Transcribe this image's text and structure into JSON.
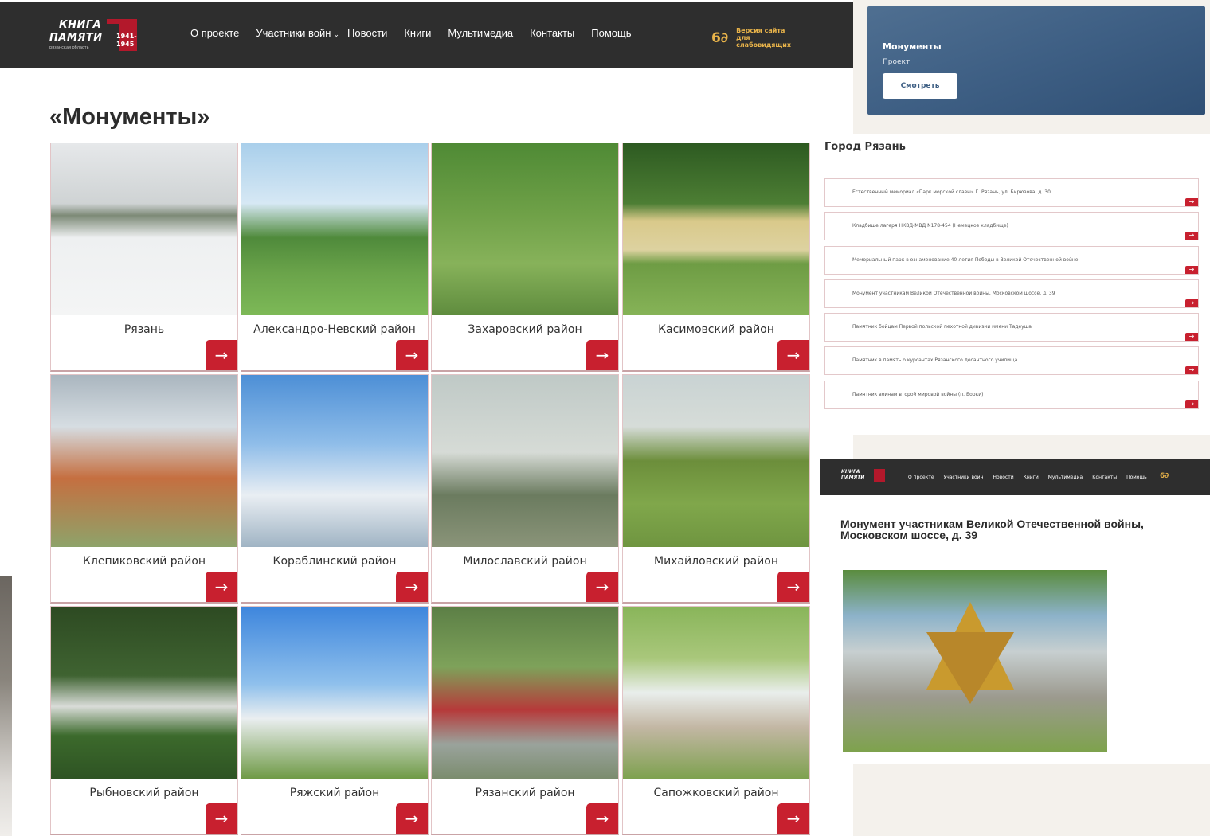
{
  "header": {
    "logo_line1": "КНИГА",
    "logo_line2": "ПАМЯТИ",
    "logo_years": "1941-\n1945",
    "logo_region": "рязанская область",
    "nav": [
      "О проекте",
      "Участники войн",
      "Новости",
      "Книги",
      "Мультимедиа",
      "Контакты",
      "Помощь"
    ],
    "accessibility_icon": "glasses-icon",
    "accessibility_label": "Версия сайта для слабовидящих"
  },
  "page_title": "«Монументы»",
  "cards": [
    {
      "name": "Рязань"
    },
    {
      "name": "Александро-Невский район"
    },
    {
      "name": "Захаровский район"
    },
    {
      "name": "Касимовский район"
    },
    {
      "name": "Клепиковский район"
    },
    {
      "name": "Кораблинский район"
    },
    {
      "name": "Милославский район"
    },
    {
      "name": "Михайловский район"
    },
    {
      "name": "Рыбновский район"
    },
    {
      "name": "Ряжский район"
    },
    {
      "name": "Рязанский район"
    },
    {
      "name": "Сапожковский район"
    }
  ],
  "banner": {
    "title": "Монументы",
    "subtitle": "Проект",
    "button": "Смотреть"
  },
  "city_list": {
    "title": "Город Рязань",
    "items": [
      "Естественный мемориал «Парк морской славы» Г. Рязань, ул. Бирюзова, д. 30.",
      "Кладбище лагеря НКВД-МВД N178-454 (Немецкое кладбище)",
      "Мемориальный парк в ознаменование 40-летия Победы в Великой Отечественной войне",
      "Монумент участникам Великой Отечественной войны, Московском шоссе, д. 39",
      "Памятник бойцам Первой польской пехотной дивизии имени Тадеуша",
      "Памятник в память о курсантах Рязанского десантного училища",
      "Памятник воинам второй мировой войны (п. Борки)"
    ]
  },
  "detail": {
    "title": "Монумент участникам Великой Отечественной войны, Московском шоссе, д. 39"
  },
  "colors": {
    "header_bg": "#2e2e2e",
    "accent_red": "#c8202f",
    "accessibility_yellow": "#e8b34a",
    "banner_blue": "#3e5f84"
  }
}
